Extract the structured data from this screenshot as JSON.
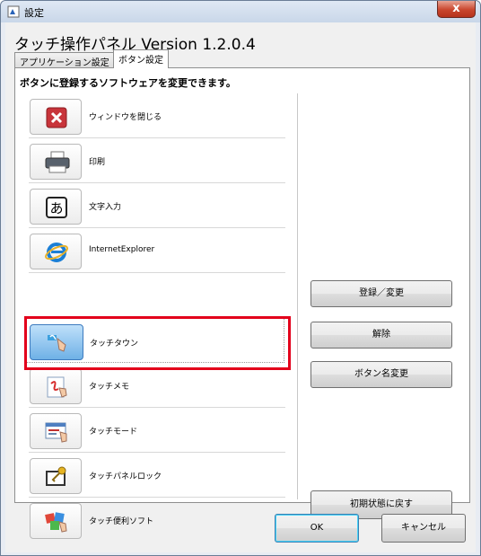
{
  "window": {
    "title": "設定",
    "close_label": "x"
  },
  "heading": "タッチ操作パネル  Version 1.2.0.4",
  "tabs": [
    {
      "label": "アプリケーション設定",
      "active": false
    },
    {
      "label": "ボタン設定",
      "active": true
    }
  ],
  "panel": {
    "description": "ボタンに登録するソフトウェアを変更できます。",
    "items": [
      {
        "label": "ウィンドウを閉じる",
        "icon": "close-window-icon"
      },
      {
        "label": "印刷",
        "icon": "printer-icon"
      },
      {
        "label": "文字入力",
        "icon": "text-input-icon",
        "icon_char": "あ"
      },
      {
        "label": "InternetExplorer",
        "icon": "internet-explorer-icon"
      },
      {
        "label": "タッチタウン",
        "icon": "touch-town-icon",
        "selected": true
      },
      {
        "label": "タッチメモ",
        "icon": "touch-memo-icon"
      },
      {
        "label": "タッチモード",
        "icon": "touch-mode-icon"
      },
      {
        "label": "タッチパネルロック",
        "icon": "panel-lock-icon"
      },
      {
        "label": "タッチ便利ソフト",
        "icon": "utility-software-icon"
      }
    ],
    "buttons": {
      "register": "登録／変更",
      "remove": "解除",
      "rename": "ボタン名変更",
      "reset": "初期状態に戻す"
    }
  },
  "footer": {
    "ok": "OK",
    "cancel": "キャンセル"
  },
  "colors": {
    "highlight": "#e3001b",
    "selected": "#6fb1e6"
  }
}
